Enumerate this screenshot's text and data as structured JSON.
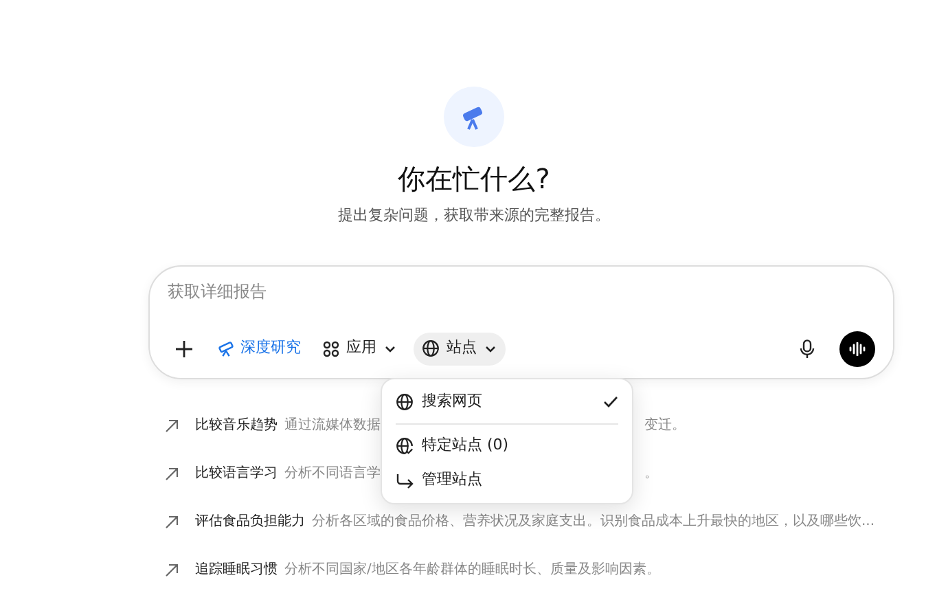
{
  "hero": {
    "title": "你在忙什么?",
    "subtitle": "提出复杂问题，获取带来源的完整报告。"
  },
  "composer": {
    "placeholder": "获取详细报告",
    "tools": [
      {
        "kind": "plus"
      },
      {
        "kind": "mode",
        "label": "深度研究",
        "selected": true
      },
      {
        "kind": "apps",
        "label": "应用",
        "expanded": false
      },
      {
        "kind": "sites",
        "label": "站点",
        "expanded": true
      }
    ]
  },
  "sites_menu": [
    {
      "kind": "globe",
      "label": "搜索网页",
      "checked": true
    },
    {
      "kind": "globe-check",
      "label": "特定站点 (0)",
      "checked": false
    },
    {
      "kind": "manage",
      "label": "管理站点",
      "checked": false
    }
  ],
  "suggestions": [
    {
      "title": "比较音乐趋势",
      "description": [
        "通过流媒体数据",
        "变迁。"
      ]
    },
    {
      "title": "比较语言学习",
      "description": [
        "分析不同语言学",
        "。"
      ]
    },
    {
      "title": "评估食品负担能力",
      "description": [
        "分析各区域的食品价格、营养状况及家庭支出。识别食品成本上升最快的地区，以及哪些饮..."
      ]
    },
    {
      "title": "追踪睡眠习惯",
      "description": [
        "分析不同国家/地区各年龄群体的睡眠时长、质量及影响因素。"
      ]
    }
  ]
}
